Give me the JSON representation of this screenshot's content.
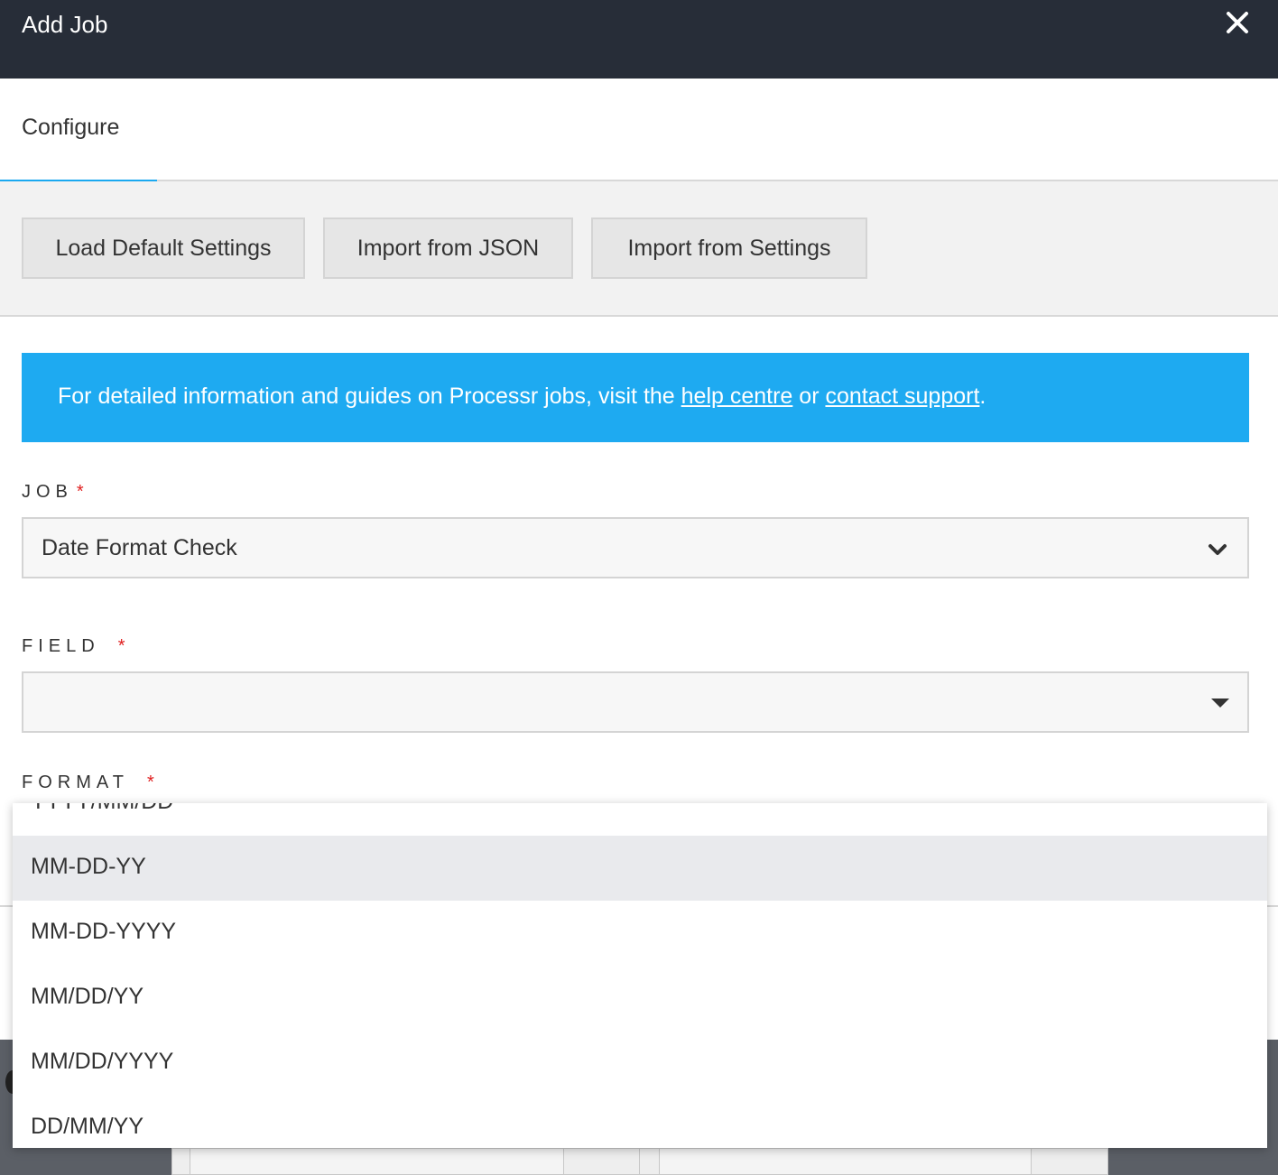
{
  "header": {
    "title": "Add Job",
    "close_icon": "close-icon"
  },
  "tabs": [
    {
      "label": "Configure",
      "active": true
    }
  ],
  "toolbar": {
    "load_default": "Load Default Settings",
    "import_json": "Import from JSON",
    "import_settings": "Import from Settings"
  },
  "info": {
    "text_before": "For detailed information and guides on Processr jobs, visit the ",
    "help_link": "help centre",
    "text_middle": " or ",
    "support_link": "contact support",
    "text_after": "."
  },
  "form": {
    "job": {
      "label": "JOB",
      "required": "*",
      "value": "Date Format Check"
    },
    "field": {
      "label": "FIELD",
      "required": "*",
      "value": ""
    },
    "format": {
      "label": "FORMAT",
      "required": "*"
    }
  },
  "format_options": [
    {
      "label": "YYYY/MM/DD",
      "highlighted": false
    },
    {
      "label": "MM-DD-YY",
      "highlighted": true
    },
    {
      "label": "MM-DD-YYYY",
      "highlighted": false
    },
    {
      "label": "MM/DD/YY",
      "highlighted": false
    },
    {
      "label": "MM/DD/YYYY",
      "highlighted": false
    },
    {
      "label": "DD/MM/YY",
      "highlighted": false
    }
  ],
  "colors": {
    "header_bg": "#272d38",
    "accent": "#1ba9f0",
    "info_bg": "#1eaaf1",
    "required": "#e02020",
    "highlight": "#e9eaed"
  }
}
